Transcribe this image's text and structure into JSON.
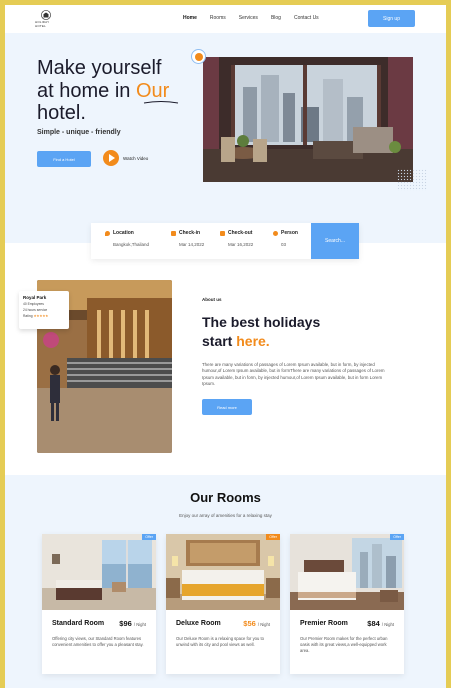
{
  "nav": {
    "logo_text": "HOLIDAY HOTEL",
    "links": [
      "Home",
      "Rooms",
      "Services",
      "Blog",
      "Contact Us"
    ],
    "signup": "Sign up"
  },
  "hero": {
    "title_line1": "Make yourself",
    "title_line2a": "at home in ",
    "title_highlight": "Our",
    "title_line3": "hotel.",
    "tagline": "Simple - unique - friendly",
    "find_button": "Find a Hotel",
    "watch_label": "Watch Video"
  },
  "booking": {
    "location": {
      "label": "Location",
      "value": "Bangkok,Thailand"
    },
    "checkin": {
      "label": "Check-in",
      "value": "Mar 14,2022"
    },
    "checkout": {
      "label": "Check-out",
      "value": "Mar 16,2022"
    },
    "person": {
      "label": "Person",
      "value": "03"
    },
    "search": "Search...",
    "icon_color": "#f28b1c"
  },
  "about": {
    "card_title": "Royal Park",
    "card_line1": "40 Employees",
    "card_line2": "24 hours service",
    "rating_label": "Rating",
    "rating_stars": "★★★★★",
    "kicker": "About us",
    "title_line1": "The best holidays",
    "title_line2a": "start ",
    "title_highlight": "here.",
    "paragraph": "There are many variations of passages of Lorem Ipsum available, but in form, by injected humour,of Lorem Ipsum available, but in formThere are many variations of passages of Lorem Ipsum available, but in form, by injected humour,of Lorem Ipsum available, but in form Lorem Ipsum.",
    "read_more": "Read more"
  },
  "rooms": {
    "title": "Our Rooms",
    "subtitle": "Enjoy our array of amenities for a relaxing stay",
    "items": [
      {
        "badge": "Offer",
        "badge_color": "#5ba4f4",
        "name": "Standard Room",
        "price": "$96",
        "unit": "/ Night",
        "desc": "Offering city views, our Standard Room features convenient amenities to offer you a pleasant stay."
      },
      {
        "badge": "Offer",
        "badge_color": "#f28b1c",
        "name": "Deluxe Room",
        "price": "$56",
        "price_color": "#f28b1c",
        "unit": "/ Night",
        "desc": "Our Deluxe Room is a relaxing space for you to unwind with its city and pool views as well."
      },
      {
        "badge": "Offer",
        "badge_color": "#5ba4f4",
        "name": "Premier  Room",
        "price": "$84",
        "unit": "/ Night",
        "desc": "Our Premier Room makes for the perfect urban oasis with its great views,a well-equipped work area."
      }
    ]
  },
  "colors": {
    "accent": "#5ba4f4",
    "highlight": "#f28b1c",
    "frame": "#e5cc55"
  }
}
